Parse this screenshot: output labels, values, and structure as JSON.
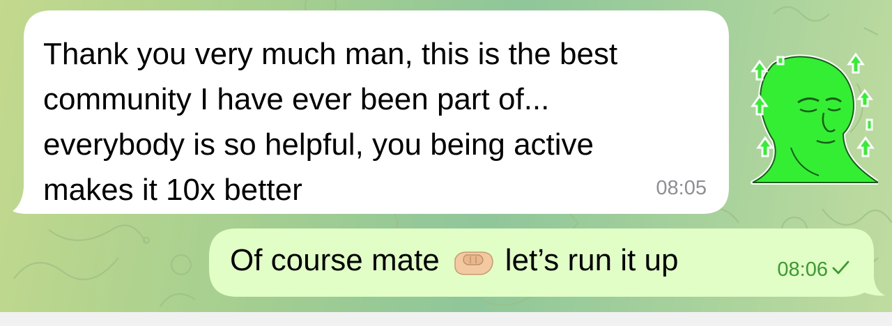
{
  "incoming_message": {
    "text": "Thank you very much man, this is the best\ncommunity I have ever been part of...\neverybody is so helpful, you being active\nmakes it 10x better",
    "time": "08:05"
  },
  "sticker": {
    "icon": "green-head-arrows-sticker-icon"
  },
  "outgoing_message": {
    "text_before": "Of course mate",
    "emoji": "fist-bump-icon",
    "text_after": "let’s run it up",
    "time": "08:06",
    "status_icon": "read-check-icon"
  },
  "colors": {
    "incoming_bubble": "#ffffff",
    "outgoing_bubble": "#e1fec6",
    "outgoing_time": "#3a9a30",
    "sticker_green": "#33ee33"
  }
}
